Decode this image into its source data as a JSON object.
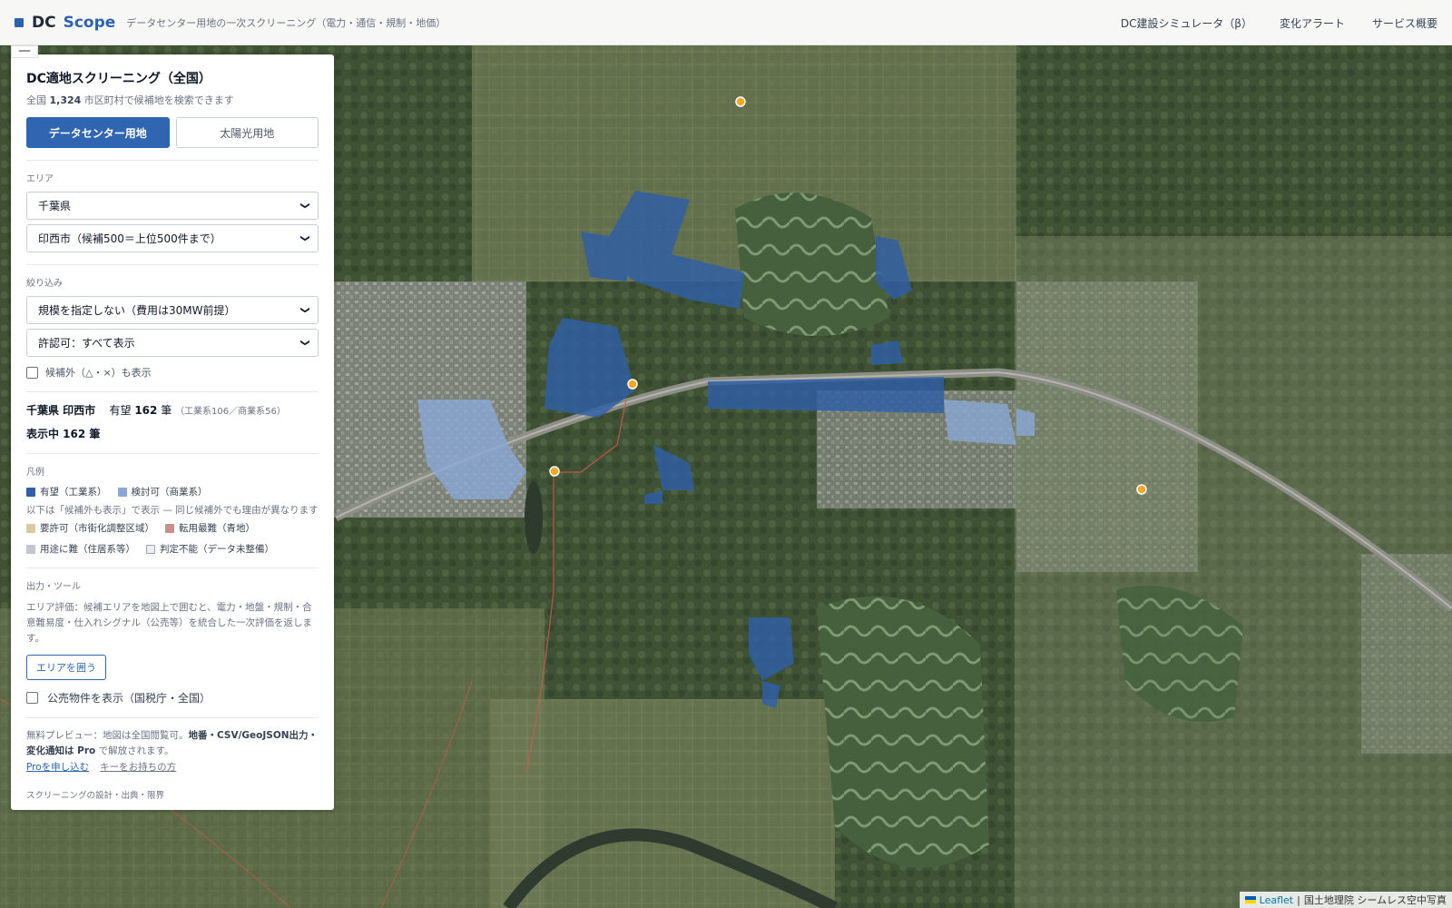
{
  "header": {
    "brand_part1": "DC",
    "brand_part2": "Scope",
    "tagline": "データセンター用地の一次スクリーニング（電力・通信・規制・地価）",
    "nav": [
      "DC建設シミュレータ（β）",
      "変化アラート",
      "サービス概要"
    ]
  },
  "panel": {
    "title": "DC適地スクリーニング（全国）",
    "subtitle_prefix": "全国 ",
    "subtitle_count": "1,324",
    "subtitle_suffix": " 市区町村で候補地を検索できます",
    "mode_on": "データセンター用地",
    "mode_off": "太陽光用地",
    "area_label": "エリア",
    "prefecture": "千葉県",
    "city": "印西市（候補500＝上位500件まで）",
    "filter_label": "絞り込み",
    "scale_filter": "規模を指定しない（費用は30MW前提）",
    "permit_filter": "許認可：すべて表示",
    "show_excluded": "候補外（△・×）も表示",
    "stat_location": "千葉県 印西市",
    "stat_label": "有望",
    "stat_count": "162",
    "stat_unit": "筆",
    "stat_breakdown": "（工業系106／商業系56）",
    "showing": "表示中 162 筆",
    "legend_label": "凡例",
    "legend_primary": [
      {
        "label": "有望（工業系）",
        "color": "#2f5fa7"
      },
      {
        "label": "検討可（商業系）",
        "color": "#8aa8d6"
      }
    ],
    "legend_note": "以下は「候補外も表示」で表示 — 同じ候補外でも理由が異なります",
    "legend_secondary_1": [
      {
        "label": "要許可（市街化調整区域）",
        "color": "#d8c9a0"
      },
      {
        "label": "転用最難（青地）",
        "color": "#c98f8a"
      }
    ],
    "legend_secondary_2": [
      {
        "label": "用途に難（住居系等）",
        "color": "#c2c6cd"
      },
      {
        "label": "判定不能（データ未整備）",
        "color": "#eceef1"
      }
    ],
    "tools_label": "出力・ツール",
    "tools_text": "エリア評価：候補エリアを地図上で囲むと、電力・地盤・規制・合意難易度・仕入れシグナル（公売等）を統合した一次評価を返します。",
    "area_button": "エリアを囲う",
    "public_sale": "公売物件を表示（国税庁・全国）",
    "pro_text_1": "無料プレビュー：地図は全国閲覧可。",
    "pro_text_bold": "地番・CSV/GeoJSON出力・変化通知は Pro",
    "pro_text_2": " で解放されます。",
    "pro_apply": "Proを申し込む",
    "pro_key": "キーをお持ちの方",
    "footer": "スクリーニングの設計・出典・限界"
  },
  "map": {
    "attribution_link": "Leaflet",
    "attribution_sep": " | ",
    "attribution_text": "国土地理院 シームレス空中写真",
    "colors": {
      "primary": "#2f5fa7",
      "commercial": "#8aa8d6",
      "marker": "#f5a623"
    }
  }
}
